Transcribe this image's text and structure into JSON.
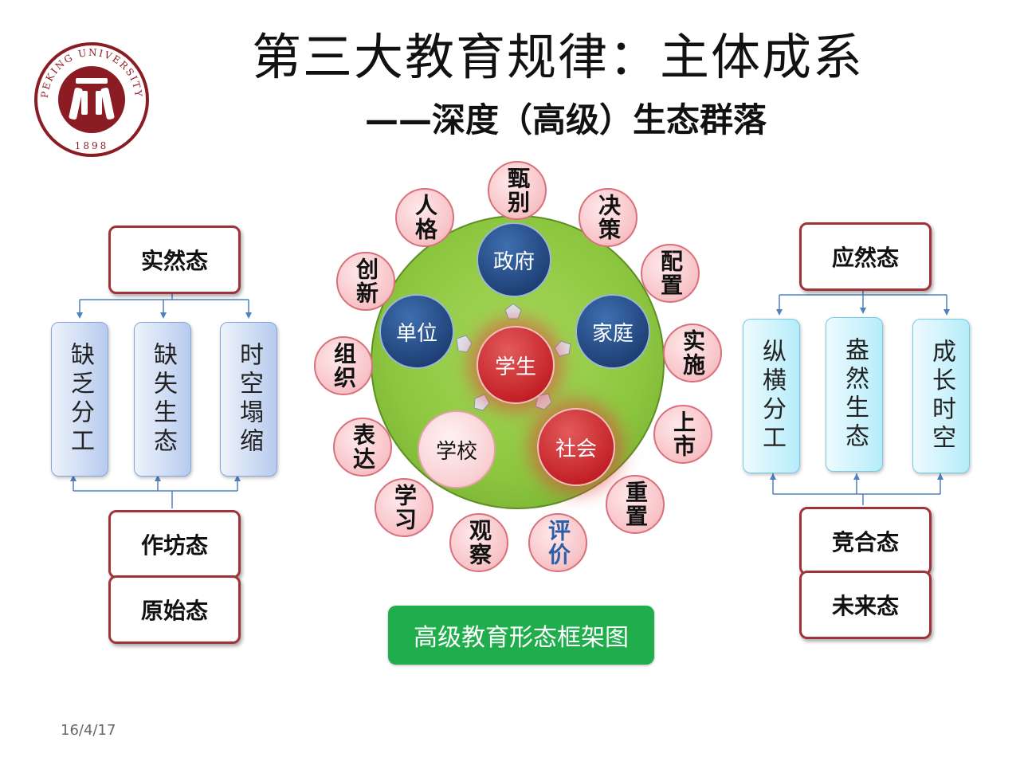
{
  "title": "第三大教育规律：主体成系",
  "subtitle": "——深度（高级）生态群落",
  "logo": {
    "ring_text": "PEKING UNIVERSITY",
    "year": "1898",
    "color": "#8b1c24"
  },
  "left": {
    "top_state": "实然态",
    "columns": [
      "缺乏分工",
      "缺失生态",
      "时空塌缩"
    ],
    "bottom_states": [
      "作坊态",
      "原始态"
    ]
  },
  "right": {
    "top_state": "应然态",
    "columns": [
      "纵横分工",
      "盎然生态",
      "成长时空"
    ],
    "bottom_states": [
      "竞合态",
      "未来态"
    ]
  },
  "center": {
    "core": "学生",
    "navy": [
      "政府",
      "单位",
      "家庭"
    ],
    "red_secondary": "社会",
    "light": "学校",
    "ring_items": [
      "甄别",
      "决策",
      "配置",
      "实施",
      "上市",
      "重置",
      "评价",
      "观察",
      "学习",
      "表达",
      "组织",
      "创新",
      "人格"
    ]
  },
  "button_label": "高级教育形态框架图",
  "date": "16/4/17",
  "colors": {
    "accent_red": "#a0333a",
    "green": "#8cc63f",
    "navy": "#1e3f74",
    "button_green": "#1fae4b",
    "highlight_text": "#2a5fa8"
  }
}
